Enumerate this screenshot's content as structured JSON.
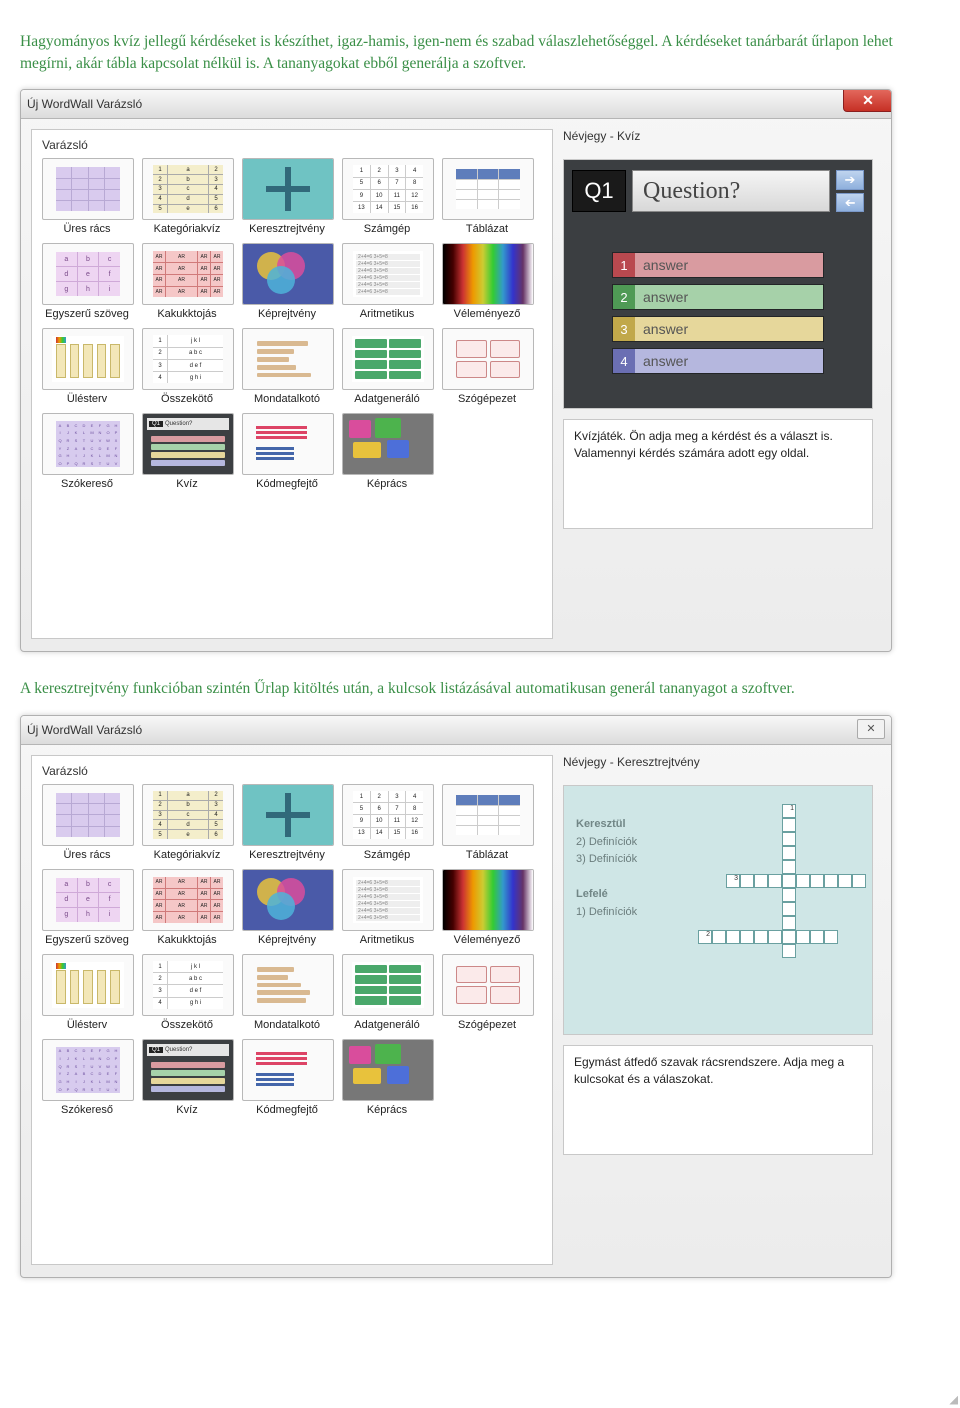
{
  "paras": {
    "p1": "Hagyományos kvíz jellegű kérdéseket is készíthet, igaz-hamis, igen-nem és szabad válaszlehetőséggel. A kérdéseket tanárbarát űrlapon lehet megírni, akár tábla kapcsolat nélkül is. A tananyagokat ebből generálja a szoftver.",
    "p2": "A keresztrejtvény funkcióban szintén Űrlap kitöltés után, a kulcsok listázásával automatikusan generál tananyagot a szoftver."
  },
  "wizard": {
    "title": "Új WordWall Varázsló",
    "left_label": "Varázsló",
    "items": [
      "Üres rács",
      "Kategóriakvíz",
      "Keresztrejtvény",
      "Számgép",
      "Táblázat",
      "Egyszerű szöveg",
      "Kakukktojás",
      "Képrejtvény",
      "Aritmetikus",
      "Véleményező",
      "Ülésterv",
      "Összekötő",
      "Mondatalkotó",
      "Adatgeneráló",
      "Szógépezet",
      "Szókereső",
      "Kvíz",
      "Kódmegfejtő",
      "Képrács"
    ]
  },
  "screen1": {
    "right_label": "Névjegy - Kvíz",
    "q_label": "Q1",
    "q_text": "Question?",
    "answers": [
      {
        "n": "1",
        "t": "answer",
        "num_bg": "#b9494f",
        "row_bg": "#d99ba0"
      },
      {
        "n": "2",
        "t": "answer",
        "num_bg": "#4f9a55",
        "row_bg": "#a6d1a9"
      },
      {
        "n": "3",
        "t": "answer",
        "num_bg": "#c1a84a",
        "row_bg": "#e6d79b"
      },
      {
        "n": "4",
        "t": "answer",
        "num_bg": "#6b6fb3",
        "row_bg": "#b5b7de"
      }
    ],
    "desc": "Kvízjáték. Ön adja meg a kérdést és a választ is. Valamennyi kérdés számára adott egy oldal."
  },
  "screen2": {
    "right_label": "Névjegy - Keresztrejtvény",
    "clues": {
      "across_h": "Keresztül",
      "across": [
        "2) Definíciók",
        "3) Definíciók"
      ],
      "down_h": "Lefelé",
      "down": [
        "1) Definíciók"
      ]
    },
    "desc": "Egymást átfedő szavak rácsrendszere. Adja meg a kulcsokat és a válaszokat."
  }
}
